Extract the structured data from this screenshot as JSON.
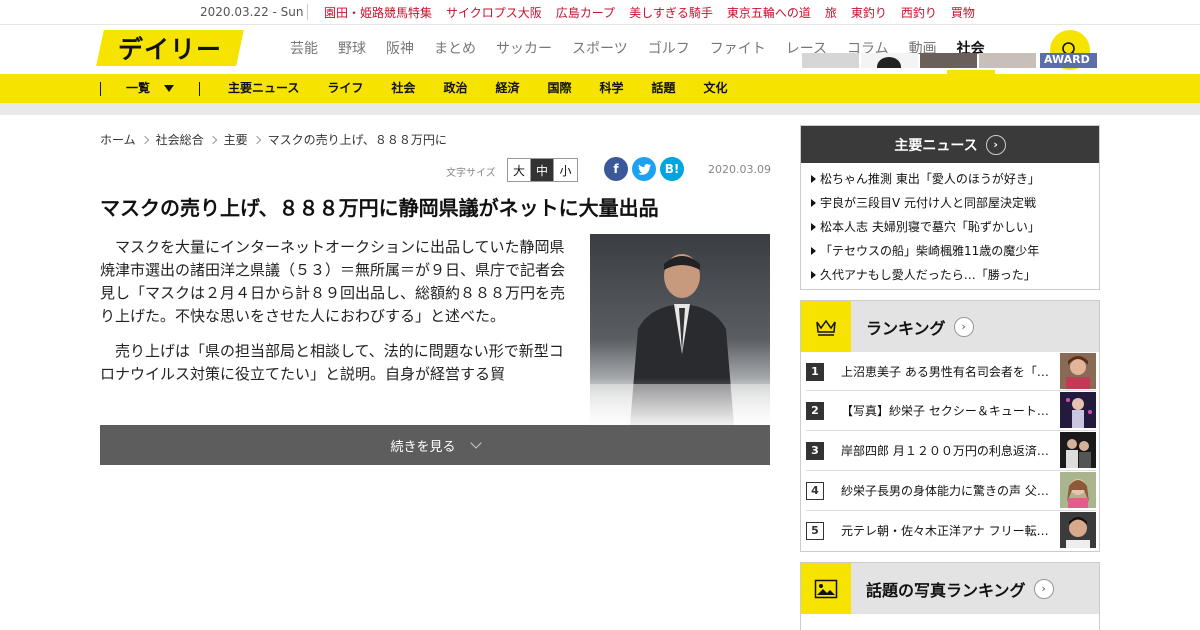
{
  "topbar": {
    "date": "2020.03.22 - Sun",
    "links": [
      "園田・姫路競馬特集",
      "サイクロプス大阪",
      "広島カープ",
      "美しすぎる騎手",
      "東京五輪への道",
      "旅",
      "東釣り",
      "西釣り",
      "買物"
    ]
  },
  "header": {
    "logo": "デイリー",
    "nav": [
      "芸能",
      "野球",
      "阪神",
      "まとめ",
      "サッカー",
      "スポーツ",
      "ゴルフ",
      "ファイト",
      "レース",
      "コラム",
      "動画",
      "社会"
    ],
    "active_nav": "社会",
    "search_icon": "search-icon"
  },
  "catbar": {
    "all_label": "一覧",
    "links": [
      "主要ニュース",
      "ライフ",
      "社会",
      "政治",
      "経済",
      "国際",
      "科学",
      "話題",
      "文化"
    ]
  },
  "breadcrumb": [
    "ホーム",
    "社会総合",
    "主要",
    "マスクの売り上げ、８８８万円に"
  ],
  "tools": {
    "font_size_label": "文字サイズ",
    "sizes": [
      "大",
      "中",
      "小"
    ],
    "selected_size": "中",
    "share": {
      "facebook": "f",
      "twitter": "t",
      "hatena": "B!"
    }
  },
  "article": {
    "date": "2020.03.09",
    "headline": "マスクの売り上げ、８８８万円に静岡県議がネットに大量出品",
    "paragraphs": [
      "マスクを大量にインターネットオークションに出品していた静岡県焼津市選出の諸田洋之県議（５３）＝無所属＝が９日、県庁で記者会見し「マスクは２月４日から計８９回出品し、総額約８８８万円を売り上げた。不快な思いをさせた人におわびする」と述べた。",
      "売り上げは「県の担当部局と相談して、法的に問題ない形で新型コロナウイルス対策に役立てたい」と説明。自身が経営する貿"
    ],
    "more_label": "続きを見る"
  },
  "news_box": {
    "title": "主要ニュース",
    "items": [
      "松ちゃん推測 東出「愛人のほうが好き」",
      "宇良が三段目V 元付け人と同部屋決定戦",
      "松本人志 夫婦別寝で墓穴「恥ずかしい」",
      "「テセウスの船」柴崎楓雅11歳の魔少年",
      "久代アナもし愛人だったら…「勝った」"
    ]
  },
  "ranking": {
    "title": "ランキング",
    "items": [
      {
        "rank": "1",
        "text": "上沼恵美子 ある男性有名司会者を「…"
      },
      {
        "rank": "2",
        "text": "【写真】紗栄子 セクシー＆キュート…"
      },
      {
        "rank": "3",
        "text": "岸部四郎 月１２００万円の利息返済…"
      },
      {
        "rank": "4",
        "text": "紗栄子長男の身体能力に驚きの声 父…"
      },
      {
        "rank": "5",
        "text": "元テレ朝・佐々木正洋アナ フリー転…"
      }
    ]
  },
  "photo_ranking": {
    "title": "話題の写真ランキング",
    "award_text": "AWARD"
  },
  "colors": {
    "brand_yellow": "#f6e400",
    "link_red": "#c8102e",
    "dark": "#3a3a3a"
  }
}
